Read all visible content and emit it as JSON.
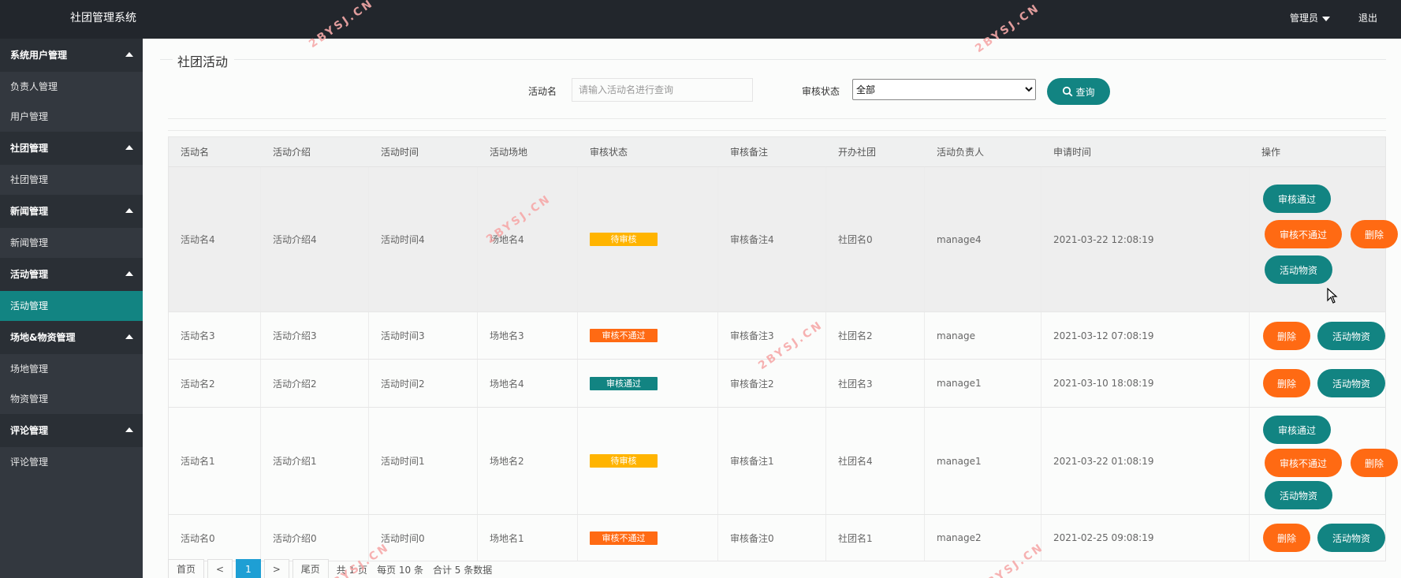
{
  "topbar": {
    "brand": "社团管理系统",
    "user": "管理员",
    "logout": "退出"
  },
  "sidebar": {
    "groups": [
      {
        "label": "系统用户管理",
        "items": [
          "负责人管理",
          "用户管理"
        ]
      },
      {
        "label": "社团管理",
        "items": [
          "社团管理"
        ]
      },
      {
        "label": "新闻管理",
        "items": [
          "新闻管理"
        ]
      },
      {
        "label": "活动管理",
        "items": [
          "活动管理"
        ]
      },
      {
        "label": "场地&物资管理",
        "items": [
          "场地管理",
          "物资管理"
        ]
      },
      {
        "label": "评论管理",
        "items": [
          "评论管理"
        ]
      }
    ],
    "active": "活动管理"
  },
  "page": {
    "title": "社团活动"
  },
  "search": {
    "name_label": "活动名",
    "name_placeholder": "请输入活动名进行查询",
    "status_label": "审核状态",
    "status_value": "全部",
    "search_button": "查询"
  },
  "table": {
    "headers": [
      "活动名",
      "活动介绍",
      "活动时间",
      "活动场地",
      "审核状态",
      "审核备注",
      "开办社团",
      "活动负责人",
      "申请时间",
      "操作"
    ],
    "rows": [
      {
        "name": "活动名4",
        "intro": "活动介绍4",
        "time": "活动时间4",
        "venue": "场地名4",
        "status": "待审核",
        "remark": "审核备注4",
        "club": "社团名0",
        "manager": "manage4",
        "applied": "2021-03-22 12:08:19"
      },
      {
        "name": "活动名3",
        "intro": "活动介绍3",
        "time": "活动时间3",
        "venue": "场地名3",
        "status": "审核不通过",
        "remark": "审核备注3",
        "club": "社团名2",
        "manager": "manage",
        "applied": "2021-03-12 07:08:19"
      },
      {
        "name": "活动名2",
        "intro": "活动介绍2",
        "time": "活动时间2",
        "venue": "场地名4",
        "status": "审核通过",
        "remark": "审核备注2",
        "club": "社团名3",
        "manager": "manage1",
        "applied": "2021-03-10 18:08:19"
      },
      {
        "name": "活动名1",
        "intro": "活动介绍1",
        "time": "活动时间1",
        "venue": "场地名2",
        "status": "待审核",
        "remark": "审核备注1",
        "club": "社团名4",
        "manager": "manage1",
        "applied": "2021-03-22 01:08:19"
      },
      {
        "name": "活动名0",
        "intro": "活动介绍0",
        "time": "活动时间0",
        "venue": "场地名1",
        "status": "审核不通过",
        "remark": "审核备注0",
        "club": "社团名1",
        "manager": "manage2",
        "applied": "2021-02-25 09:08:19"
      }
    ],
    "actions": {
      "approve": "审核通过",
      "reject": "审核不通过",
      "delete": "删除",
      "supplies": "活动物资"
    }
  },
  "pager": {
    "first": "首页",
    "prev": "<",
    "current": "1",
    "next": ">",
    "last": "尾页",
    "total_pages": "共 1 页",
    "per_page": "每页 10 条",
    "total": "合计 5 条数据"
  },
  "watermark": "2BYSJ.CN",
  "colors": {
    "teal": "#128482",
    "orange": "#ff6a13",
    "pending": "#ffb400",
    "pager_current": "#1e9fd4"
  },
  "icons": [
    "caret-down-icon",
    "collapse-arrow-icon",
    "search-icon",
    "mouse-cursor-icon"
  ]
}
